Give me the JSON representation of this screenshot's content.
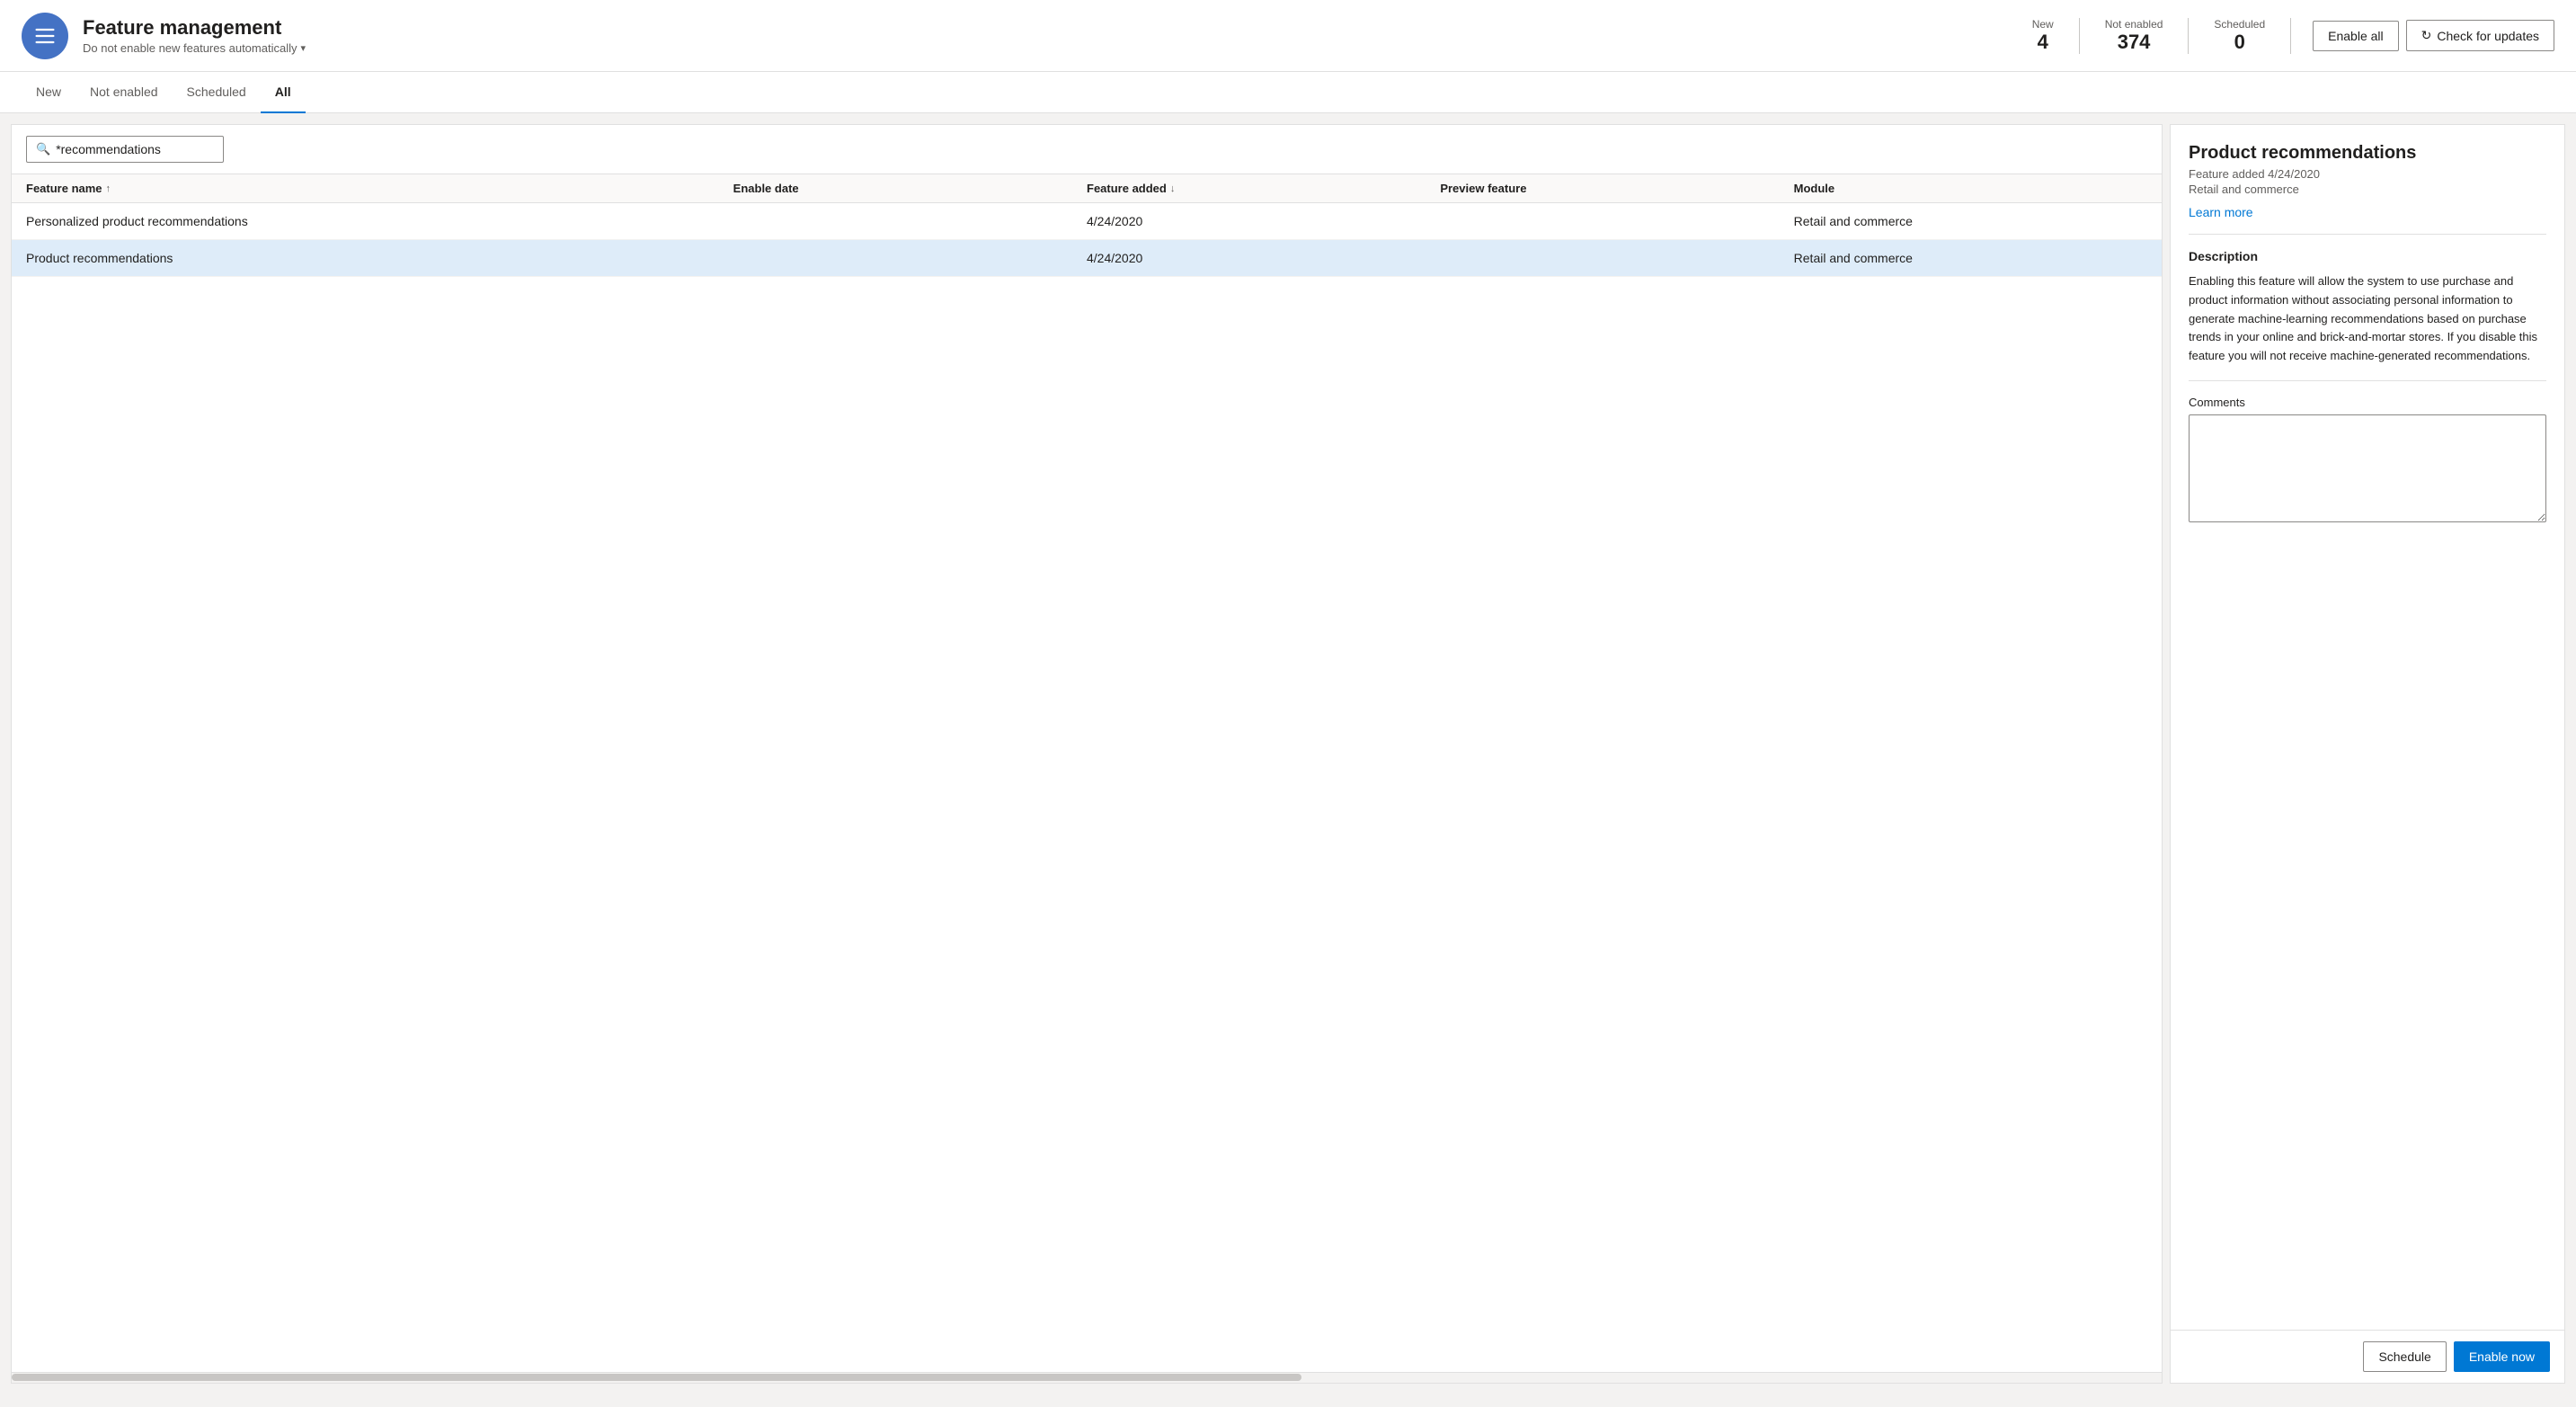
{
  "header": {
    "title": "Feature management",
    "subtitle": "Do not enable new features automatically",
    "subtitle_chevron": "▾",
    "stats": [
      {
        "label": "New",
        "value": "4"
      },
      {
        "label": "Not enabled",
        "value": "374"
      },
      {
        "label": "Scheduled",
        "value": "0"
      }
    ],
    "enable_all_label": "Enable all",
    "check_updates_label": "Check for updates"
  },
  "tabs": [
    {
      "label": "New",
      "active": false
    },
    {
      "label": "Not enabled",
      "active": false
    },
    {
      "label": "Scheduled",
      "active": false
    },
    {
      "label": "All",
      "active": true
    }
  ],
  "search": {
    "placeholder": "",
    "value": "*recommendations"
  },
  "table": {
    "columns": [
      {
        "label": "Feature name",
        "sort": "↑"
      },
      {
        "label": "Enable date",
        "sort": ""
      },
      {
        "label": "Feature added",
        "sort": "↓"
      },
      {
        "label": "Preview feature",
        "sort": ""
      },
      {
        "label": "Module",
        "sort": ""
      }
    ],
    "rows": [
      {
        "feature_name": "Personalized product recommendations",
        "enable_date": "",
        "feature_added": "4/24/2020",
        "preview_feature": "",
        "module": "Retail and commerce",
        "selected": false
      },
      {
        "feature_name": "Product recommendations",
        "enable_date": "",
        "feature_added": "4/24/2020",
        "preview_feature": "",
        "module": "Retail and commerce",
        "selected": true
      }
    ]
  },
  "detail": {
    "title": "Product recommendations",
    "feature_added": "Feature added 4/24/2020",
    "module": "Retail and commerce",
    "learn_more": "Learn more",
    "description_title": "Description",
    "description": "Enabling this feature will allow the system to use purchase and product information without associating personal information to generate machine-learning recommendations based on purchase trends in your online and brick-and-mortar stores. If you disable this feature you will not receive machine-generated recommendations.",
    "comments_label": "Comments",
    "schedule_label": "Schedule",
    "enable_now_label": "Enable now"
  },
  "icons": {
    "list": "☰",
    "search": "🔍",
    "refresh": "↻"
  }
}
